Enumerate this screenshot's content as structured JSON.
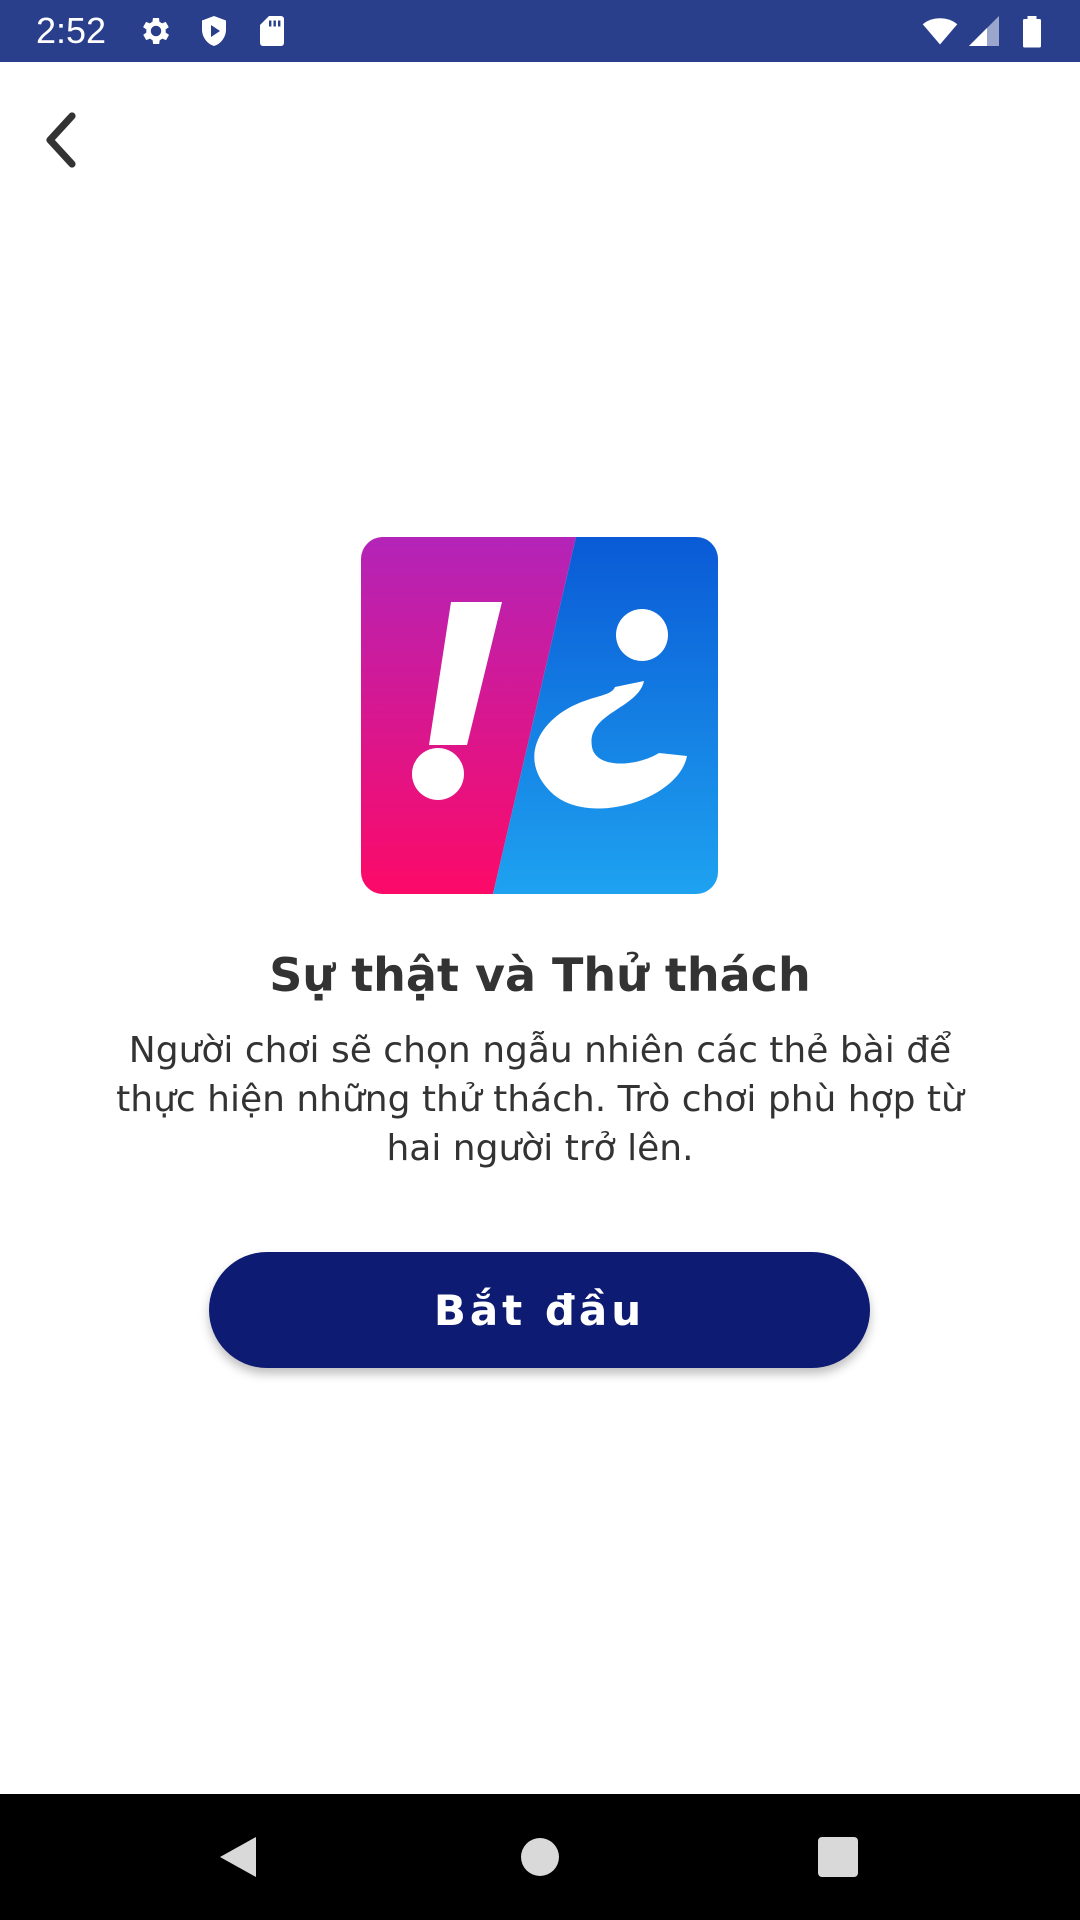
{
  "status_bar": {
    "time": "2:52",
    "background": "#2a3f8c",
    "left_icons": [
      "settings-icon",
      "shield-icon",
      "sd-card-icon"
    ],
    "right_icons": [
      "wifi-icon",
      "cell-signal-icon",
      "battery-icon"
    ]
  },
  "header": {
    "back_icon": "chevron-left-icon"
  },
  "game": {
    "logo_icon": "truth-or-dare-logo",
    "logo_colors": {
      "left_top": "#b324b8",
      "left_bottom": "#fc0a68",
      "right_top": "#0a5ad6",
      "right_bottom": "#1ea2f0"
    },
    "title": "Sự thật và Thử thách",
    "description": "Người chơi sẽ chọn ngẫu nhiên các thẻ bài để thực hiện những thử thách. Trò chơi phù hợp từ hai người trở lên.",
    "start_label": "Bắt đầu",
    "start_color": "#0d1b72"
  },
  "nav_bar": {
    "buttons": [
      "back-triangle-icon",
      "home-circle-icon",
      "recents-square-icon"
    ]
  }
}
